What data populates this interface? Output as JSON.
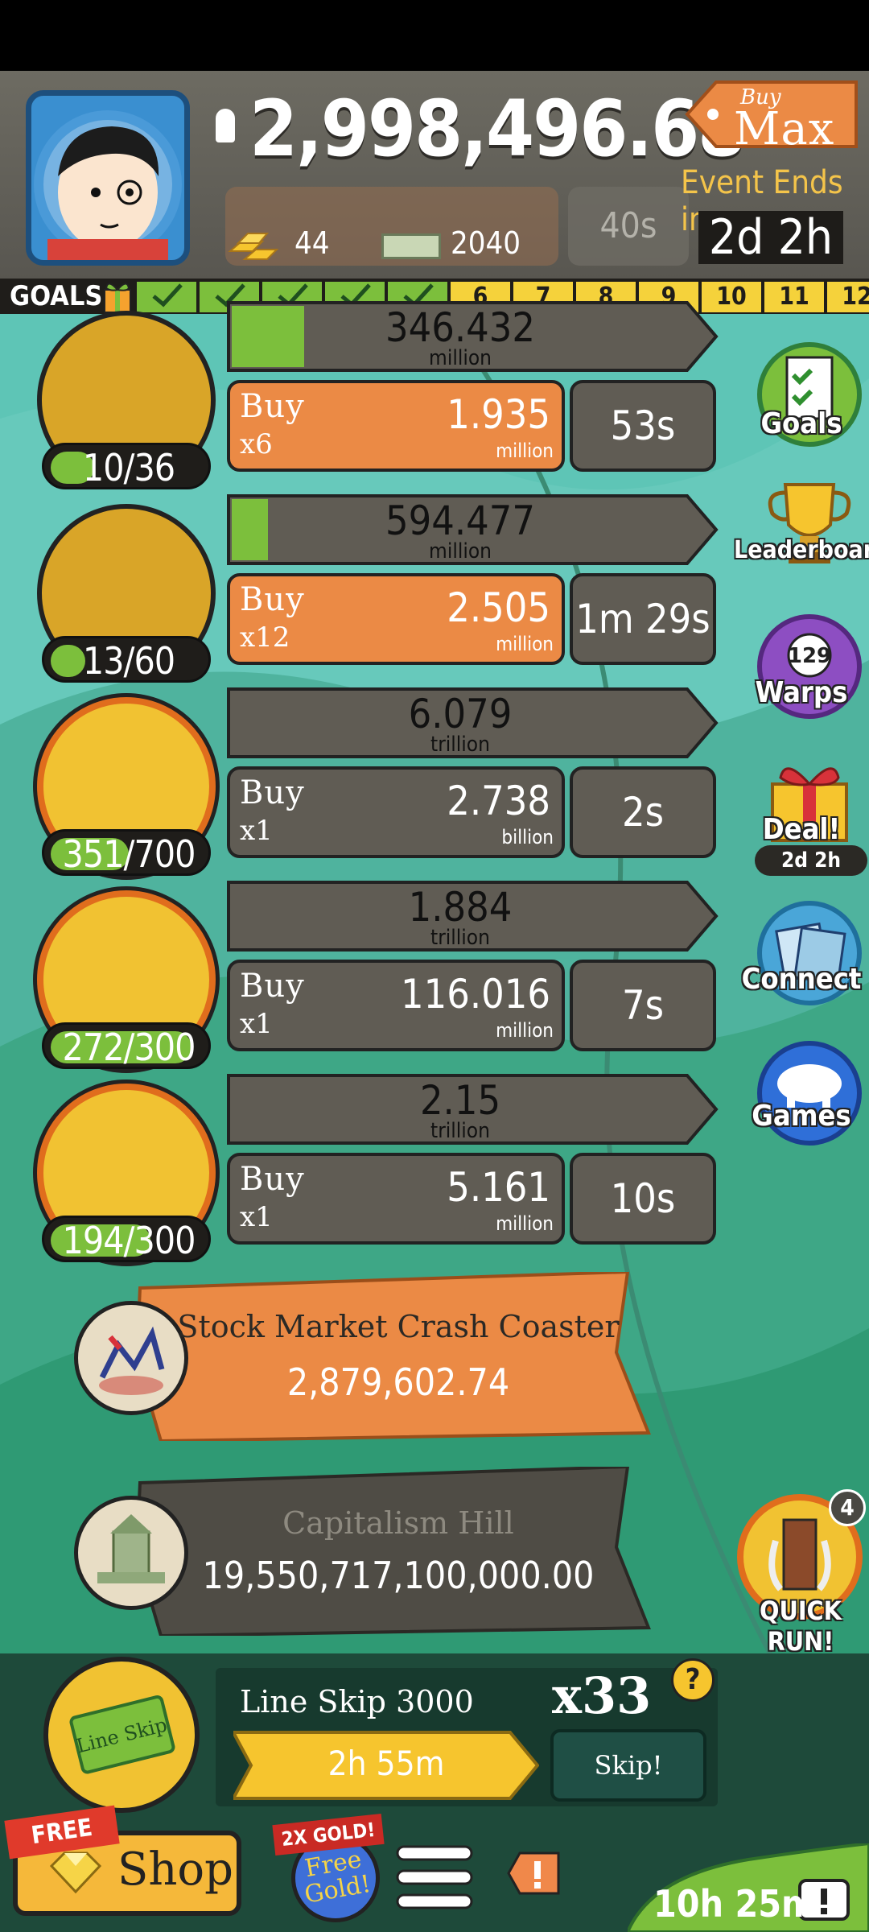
{
  "header": {
    "money": "2,998,496.68",
    "buy_max": {
      "buy": "Buy",
      "max": "Max"
    },
    "event_label": "Event Ends in:",
    "event_time": "2d 2h",
    "gold_count": "44",
    "tickets_count": "2040",
    "ghost_timer": "40s"
  },
  "goals": {
    "label": "GOALS",
    "completed": 5,
    "numbers": [
      "6",
      "7",
      "8",
      "9",
      "10",
      "11",
      "12"
    ]
  },
  "businesses": [
    {
      "count": "10/36",
      "progress": 0.28,
      "revenue": "346.432",
      "revenue_unit": "million",
      "rev_fill": 0.16,
      "buy_label": "Buy",
      "buy_mult": "x6",
      "cost": "1.935",
      "cost_unit": "million",
      "timer": "53s",
      "affordable": true
    },
    {
      "count": "13/60",
      "progress": 0.22,
      "revenue": "594.477",
      "revenue_unit": "million",
      "rev_fill": 0.08,
      "buy_label": "Buy",
      "buy_mult": "x12",
      "cost": "2.505",
      "cost_unit": "million",
      "timer": "1m 29s",
      "affordable": true
    },
    {
      "count": "351/700",
      "progress": 0.5,
      "revenue": "6.079",
      "revenue_unit": "trillion",
      "rev_fill": 0,
      "buy_label": "Buy",
      "buy_mult": "x1",
      "cost": "2.738",
      "cost_unit": "billion",
      "timer": "2s",
      "affordable": false
    },
    {
      "count": "272/300",
      "progress": 0.9,
      "revenue": "1.884",
      "revenue_unit": "trillion",
      "rev_fill": 0,
      "buy_label": "Buy",
      "buy_mult": "x1",
      "cost": "116.016",
      "cost_unit": "million",
      "timer": "7s",
      "affordable": false
    },
    {
      "count": "194/300",
      "progress": 0.64,
      "revenue": "2.15",
      "revenue_unit": "trillion",
      "rev_fill": 0,
      "buy_label": "Buy",
      "buy_mult": "x1",
      "cost": "5.161",
      "cost_unit": "million",
      "timer": "10s",
      "affordable": false
    }
  ],
  "side": {
    "goals": "Goals",
    "leaderboard": "Leaderboard",
    "warps": "Warps",
    "warps_count": "129",
    "deal": "Deal!",
    "deal_time": "2d 2h",
    "connect": "Connect",
    "games": "Games"
  },
  "planets": [
    {
      "name": "Stock Market Crash Coaster",
      "value": "2,879,602.74"
    },
    {
      "name": "Capitalism Hill",
      "value": "19,550,717,100,000.00"
    }
  ],
  "quick_run": {
    "label": "QUICK RUN!",
    "badge": "4"
  },
  "line_skip": {
    "title": "Line Skip 3000",
    "multiplier": "x33",
    "help": "?",
    "timer": "2h 55m",
    "skip": "Skip!",
    "icon_text": "Line Skip"
  },
  "bottom": {
    "free_badge": "FREE",
    "shop": "Shop",
    "gold_badge": "2X GOLD!",
    "free_gold": "Free Gold!",
    "tv_timer": "10h 25m"
  },
  "colors": {
    "accent_orange": "#eb8a45",
    "goal_done": "#7cbf3c",
    "goal_todo": "#f5d23b",
    "background": "#5ec5b6"
  }
}
